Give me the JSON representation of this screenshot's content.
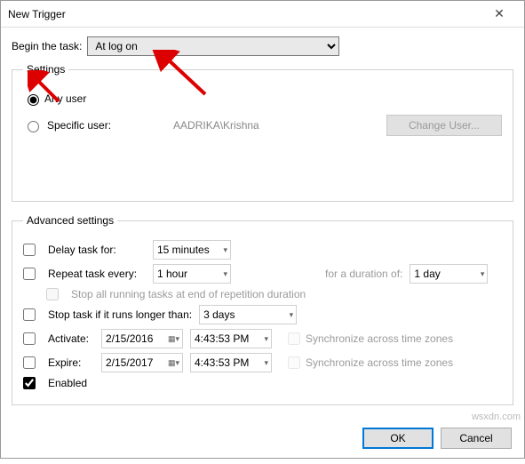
{
  "title": "New Trigger",
  "beginLabel": "Begin the task:",
  "beginValue": "At log on",
  "settings": {
    "legend": "Settings",
    "anyUser": "Any user",
    "specificUser": "Specific user:",
    "userValue": "AADRIKA\\Krishna",
    "changeUser": "Change User..."
  },
  "advanced": {
    "legend": "Advanced settings",
    "delayLabel": "Delay task for:",
    "delayValue": "15 minutes",
    "repeatLabel": "Repeat task every:",
    "repeatValue": "1 hour",
    "durationLabel": "for a duration of:",
    "durationValue": "1 day",
    "stopAll": "Stop all running tasks at end of repetition duration",
    "stopIfLabel": "Stop task if it runs longer than:",
    "stopIfValue": "3 days",
    "activateLabel": "Activate:",
    "activateDate": "2/15/2016",
    "activateTime": "4:43:53 PM",
    "expireLabel": "Expire:",
    "expireDate": "2/15/2017",
    "expireTime": "4:43:53 PM",
    "syncLabel": "Synchronize across time zones",
    "enabledLabel": "Enabled"
  },
  "buttons": {
    "ok": "OK",
    "cancel": "Cancel"
  },
  "watermark": "wsxdn.com"
}
